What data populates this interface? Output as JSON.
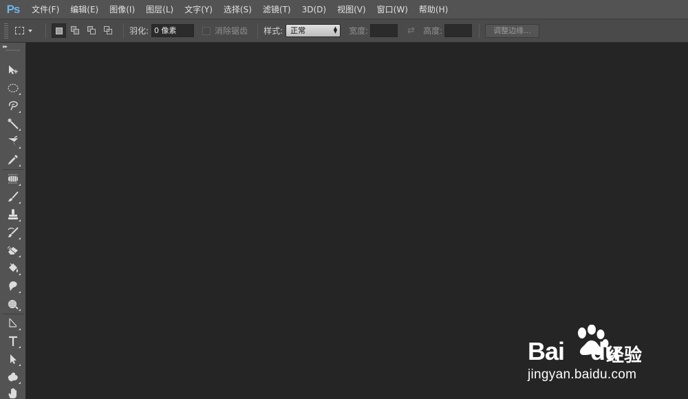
{
  "app": {
    "logo_text": "Ps",
    "accent_color": "#6fb4e8"
  },
  "menubar": {
    "items": [
      {
        "label": "文件(F)"
      },
      {
        "label": "编辑(E)"
      },
      {
        "label": "图像(I)"
      },
      {
        "label": "图层(L)"
      },
      {
        "label": "文字(Y)"
      },
      {
        "label": "选择(S)"
      },
      {
        "label": "滤镜(T)"
      },
      {
        "label": "3D(D)"
      },
      {
        "label": "视图(V)"
      },
      {
        "label": "窗口(W)"
      },
      {
        "label": "帮助(H)"
      }
    ]
  },
  "options": {
    "feather_label": "羽化:",
    "feather_value": "0 像素",
    "antialias_label": "消除锯齿",
    "antialias_checked": false,
    "style_label": "样式:",
    "style_value": "正常",
    "width_label": "宽度:",
    "width_value": "",
    "height_label": "高度:",
    "height_value": "",
    "refine_edge_label": "调整边缘..."
  },
  "toolbar": {
    "tools": [
      {
        "name": "move-tool",
        "icon": "move-icon"
      },
      {
        "name": "elliptical-marquee-tool",
        "icon": "ellipse-marquee-icon"
      },
      {
        "name": "lasso-tool",
        "icon": "lasso-icon"
      },
      {
        "name": "magic-wand-tool",
        "icon": "magic-wand-icon"
      },
      {
        "name": "crop-tool",
        "icon": "crop-icon"
      },
      {
        "name": "eyedropper-tool",
        "icon": "eyedropper-icon"
      },
      {
        "name": "spot-healing-tool",
        "icon": "healing-brush-icon"
      },
      {
        "name": "brush-tool",
        "icon": "brush-icon"
      },
      {
        "name": "clone-stamp-tool",
        "icon": "stamp-icon"
      },
      {
        "name": "history-brush-tool",
        "icon": "history-brush-icon"
      },
      {
        "name": "eraser-tool",
        "icon": "eraser-icon"
      },
      {
        "name": "paint-bucket-tool",
        "icon": "paint-bucket-icon"
      },
      {
        "name": "blur-tool",
        "icon": "blur-icon"
      },
      {
        "name": "dodge-tool",
        "icon": "dodge-icon"
      },
      {
        "name": "pen-tool",
        "icon": "pen-icon"
      },
      {
        "name": "type-tool",
        "icon": "type-icon"
      },
      {
        "name": "path-selection-tool",
        "icon": "path-selection-icon"
      },
      {
        "name": "custom-shape-tool",
        "icon": "custom-shape-icon"
      },
      {
        "name": "hand-tool",
        "icon": "hand-icon"
      }
    ]
  },
  "watermark": {
    "logo_bai": "Bai",
    "logo_du": "du",
    "logo_jingyan": "经验",
    "url": "jingyan.baidu.com"
  }
}
